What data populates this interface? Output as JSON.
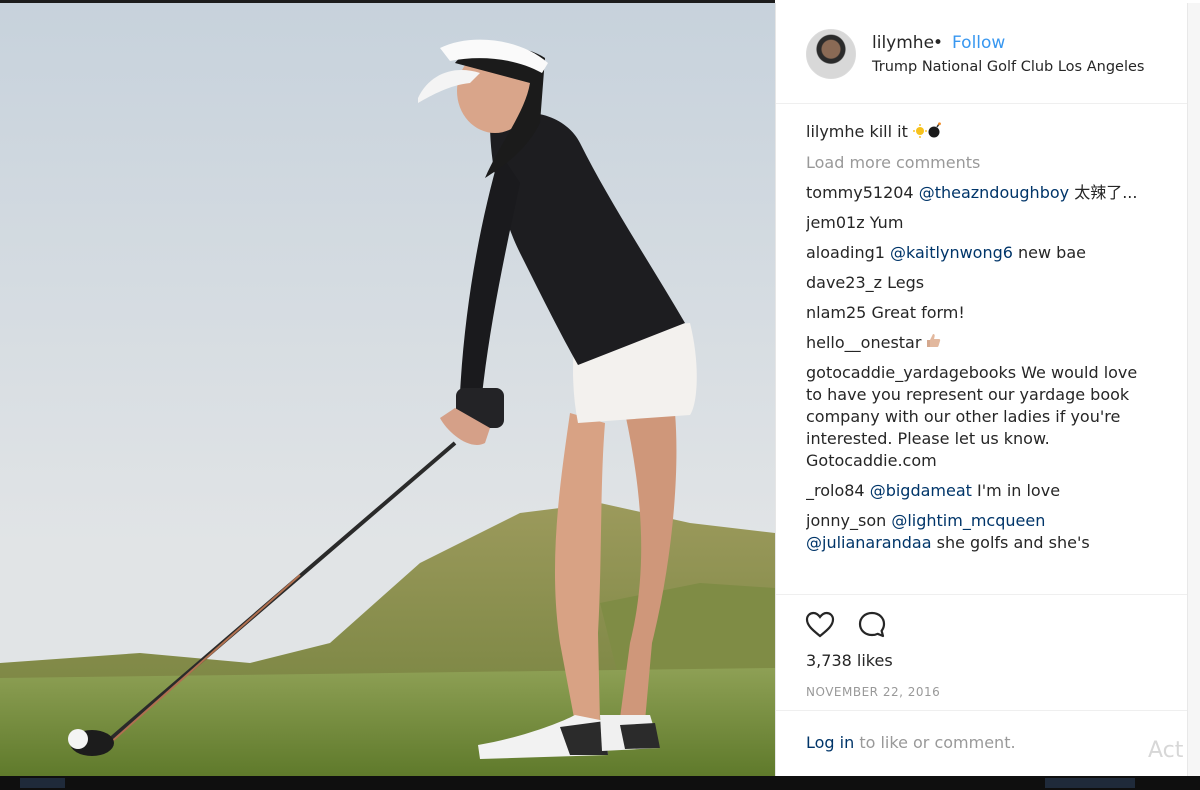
{
  "post": {
    "username": "lilymhe",
    "separator": "•",
    "follow_label": "Follow",
    "location": "Trump National Golf Club Los Angeles"
  },
  "caption": {
    "username": "lilymhe",
    "text": "kill it"
  },
  "load_more_label": "Load more comments",
  "comments": [
    {
      "user": "tommy51204",
      "mention": "@theazndoughboy",
      "text": " 太辣了..."
    },
    {
      "user": "jem01z",
      "mention": "",
      "text": "Yum"
    },
    {
      "user": "aloading1",
      "mention": "@kaitlynwong6",
      "text": " new bae"
    },
    {
      "user": "dave23_z",
      "mention": "",
      "text": "Legs"
    },
    {
      "user": "nlam25",
      "mention": "",
      "text": "Great form!"
    },
    {
      "user": "hello__onestar",
      "mention": "",
      "text": ""
    },
    {
      "user": "gotocaddie_yardagebooks",
      "mention": "",
      "text": "We would love to have you represent our yardage book company with our other ladies if you're interested. Please let us know. Gotocaddie.com"
    },
    {
      "user": "_rolo84",
      "mention": "@bigdameat",
      "text": " I'm in love"
    },
    {
      "user": "jonny_son",
      "mention": "@lightim_mcqueen @julianarandaa",
      "text": " she golfs and she's"
    }
  ],
  "likes": "3,738 likes",
  "date": "NOVEMBER 22, 2016",
  "login": {
    "link": "Log in",
    "rest": " to like or comment."
  },
  "watermark": "Act",
  "icons": {
    "like": "heart-icon",
    "comment": "comment-bubble-icon"
  },
  "colors": {
    "link": "#3897f0",
    "mention": "#003569",
    "muted": "#999999"
  }
}
